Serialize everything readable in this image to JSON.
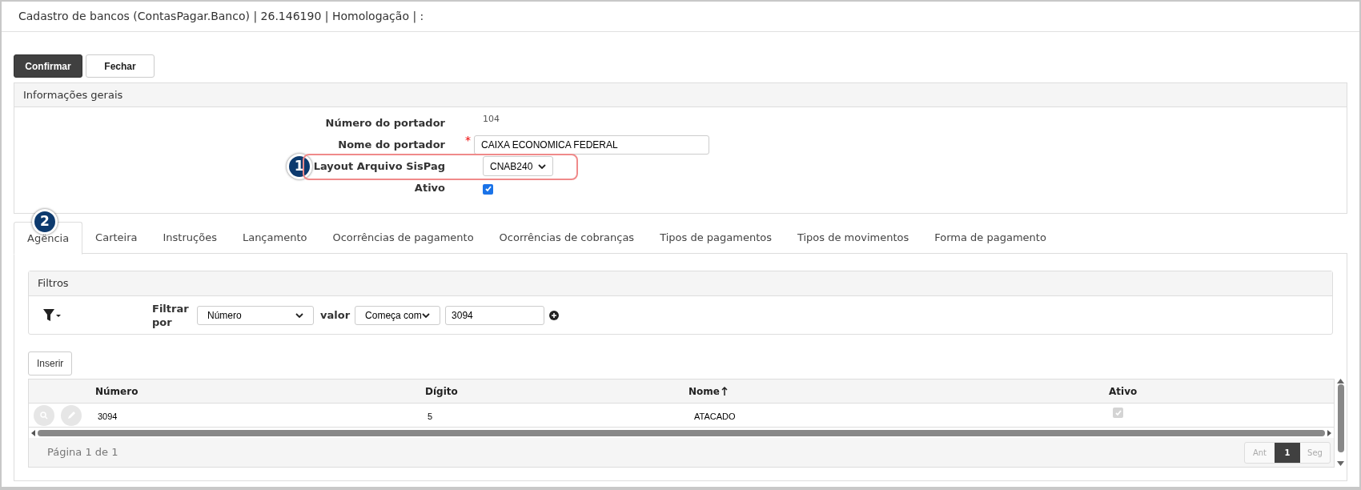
{
  "window": {
    "title": "Cadastro de bancos (ContasPagar.Banco) | 26.146190 | Homologação | :"
  },
  "buttons": [
    {
      "label": "Confirmar",
      "kind": "primary"
    },
    {
      "label": "Fechar",
      "kind": "default"
    }
  ],
  "general": {
    "title": "Informações gerais",
    "fields": [
      {
        "label": "Número do portador",
        "kind": "text",
        "value": "104"
      },
      {
        "label": "Nome do portador",
        "kind": "input",
        "required_mark": "*",
        "value": "CAIXA ECONOMICA FEDERAL"
      },
      {
        "label": "Layout Arquivo SisPag",
        "kind": "select",
        "value": "CNAB240",
        "callout": "1"
      },
      {
        "label": "Ativo",
        "kind": "checkbox",
        "checked": true
      }
    ]
  },
  "tabs_callout": "2",
  "tabs": [
    {
      "label": "Agência",
      "selected": true
    },
    {
      "label": "Carteira",
      "selected": false
    },
    {
      "label": "Instruções",
      "selected": false
    },
    {
      "label": "Lançamento",
      "selected": false
    },
    {
      "label": "Ocorrências de pagamento",
      "selected": false
    },
    {
      "label": "Ocorrências de cobranças",
      "selected": false
    },
    {
      "label": "Tipos de pagamentos",
      "selected": false
    },
    {
      "label": "Tipos de movimentos",
      "selected": false
    },
    {
      "label": "Forma de pagamento",
      "selected": false
    }
  ],
  "filters": {
    "title": "Filtros",
    "filter_label": "Filtrar por",
    "field": "Número",
    "value_label": "valor",
    "operator": "Começa com",
    "value": "3094"
  },
  "insert_button": "Inserir",
  "table": {
    "columns": [
      {
        "label": "Número",
        "sorted": false
      },
      {
        "label": "Dígito",
        "sorted": false
      },
      {
        "label": "Nome",
        "sorted": true
      },
      {
        "label": "Ativo",
        "sorted": false
      }
    ],
    "rows": [
      {
        "numero": "3094",
        "digito": "5",
        "nome": "ATACADO",
        "ativo": true
      }
    ]
  },
  "pagination": {
    "info": "Página 1 de 1",
    "prev": "Ant",
    "pages": [
      {
        "label": "1",
        "selected": true
      }
    ],
    "next": "Seg"
  }
}
